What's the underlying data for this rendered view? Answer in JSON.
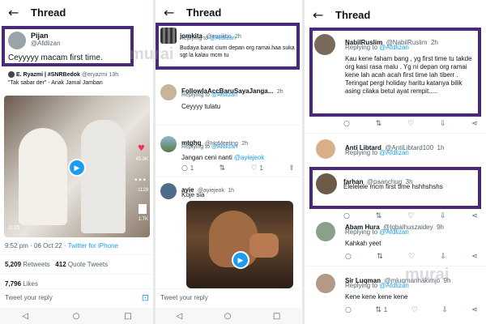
{
  "p1": {
    "back": "←",
    "title": "Thread",
    "main": {
      "name": "Pijan",
      "handle": "@Afdlizan",
      "text": "Ceyyyyy macam first time."
    },
    "quoted": {
      "name": "E. Ryazmi | #SNRBedok",
      "handle": "@eryazmi",
      "time": "13h",
      "text": "\"Tak sabar der\" - Anak Jamal Jamban",
      "duration": "0:25",
      "likes": "45.0K",
      "comments": "1129",
      "reads": "1.7K"
    },
    "meta": {
      "time": "9:52 pm · 06 Oct 22 · ",
      "client": "Twitter for iPhone"
    },
    "stats": {
      "rt_count": "5,209",
      "rt_label": "Retweets",
      "qt_count": "412",
      "qt_label": "Quote Tweets",
      "likes_count": "7,796",
      "likes_label": "Likes"
    },
    "tweet_reply": "Tweet your reply"
  },
  "p2": {
    "back": "←",
    "title": "Thread",
    "t1": {
      "name": "jomkita",
      "handle": "@encikbo",
      "time": "2h",
      "reply_prefix": "Replying to",
      "reply_to": "@Afdlizan",
      "text": "Budaya barat cium depan org ramai.haa suka sgt la kalau mcm tu"
    },
    "t2": {
      "name": "FollowlaAccBaruSayaJanga...",
      "time": "2h",
      "reply_prefix": "Replying to",
      "reply_to": "@Afdlizan",
      "text": "Ceyyyy tulatu"
    },
    "t3": {
      "name": "mtghq",
      "handle": "@HqMeeting",
      "time": "2h",
      "reply_prefix": "Replying to",
      "reply_to": "@Afdlizan",
      "text_prefix": "Jangan ceni nanti ",
      "text_mention": "@ayiejeok",
      "a_reply": "1",
      "a_like": "1"
    },
    "t4": {
      "name": "ayie",
      "handle": "@ayiejeok",
      "time": "1h",
      "text": "Koje sia"
    },
    "tweet_reply": "Tweet your reply"
  },
  "p3": {
    "back": "←",
    "title": "Thread",
    "t1": {
      "name": "NabilRuslim",
      "handle": "@NabilRuslim",
      "time": "2h",
      "reply_prefix": "Replying to",
      "reply_to": "@Afdlizan",
      "text": "Kau kene faham bang , yg first time tu takde org kasi rasa malu . Yg ni depan org ramai kene lah acah acah first time lah tiberr . Teringat pergi holiday haritu katanya bilik asing cilaka betul ayat rempit....."
    },
    "t2": {
      "name": "Anti Libtard",
      "handle": "@AntiLibtard100",
      "time": "1h",
      "reply_prefix": "Replying to",
      "reply_to": "@Afdlizan"
    },
    "t3": {
      "name": "farhan",
      "handle": "@paanchug",
      "time": "3h",
      "text": "Elelelele mcm first time hshhshshs"
    },
    "t4": {
      "name": "Abam Hura",
      "handle": "@Iqbalhuszaidey",
      "time": "9h",
      "reply_prefix": "Replying to",
      "reply_to": "@Afdlizan",
      "text": "Kahkah yeet"
    },
    "t5": {
      "name": "Sir Luqman",
      "handle": "@mluqmanhakimjo",
      "time": "9h",
      "reply_prefix": "Replying to",
      "reply_to": "@Afdlizan",
      "text": "Kene kene kene kene",
      "a_rt": "1"
    }
  },
  "watermark": "murai"
}
